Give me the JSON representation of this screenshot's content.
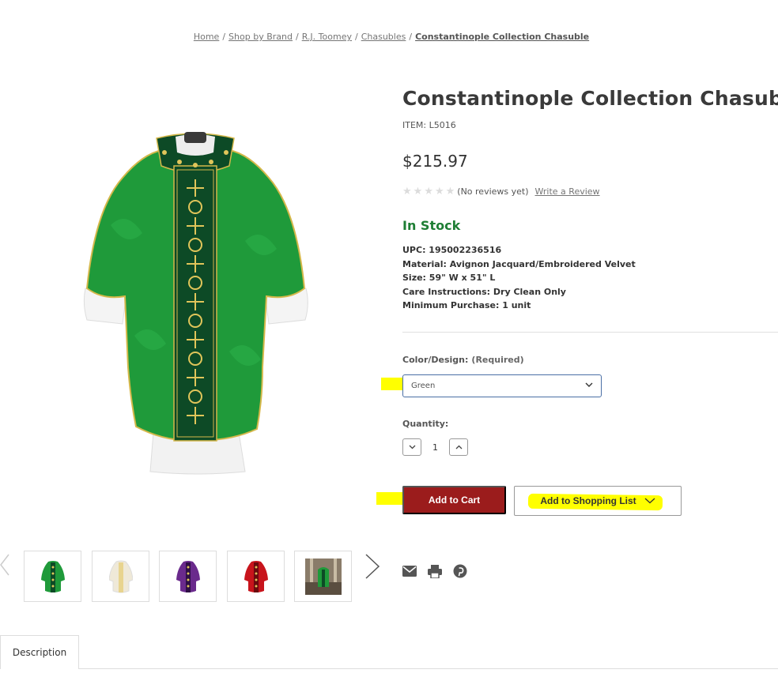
{
  "breadcrumbs": {
    "items": [
      "Home",
      "Shop by Brand",
      "R.J. Toomey",
      "Chasubles",
      "Constantinople Collection Chasuble"
    ],
    "separator": "/"
  },
  "product": {
    "title": "Constantinople Collection Chasuble",
    "sku": "ITEM: L5016",
    "price": "$215.97",
    "rating": {
      "stars": 0,
      "max_stars": 5,
      "reviews_text": "(No reviews yet)",
      "write_review": "Write a Review"
    },
    "stock": "In Stock",
    "specs": [
      "UPC: 195002236516",
      "Material: Avignon Jacquard/Embroidered Velvet",
      "Size: 59\" W x 51\" L",
      "Care Instructions: Dry Clean Only",
      "Minimum Purchase: 1 unit"
    ]
  },
  "form": {
    "color_label": "Color/Design:",
    "color_required": "(Required)",
    "color_value": "Green",
    "quantity_label": "Quantity:",
    "quantity_value": "1"
  },
  "actions": {
    "add_to_cart": "Add to Cart",
    "add_to_list": "Add to Shopping List"
  },
  "thumbnails": [
    {
      "name": "green-chasuble",
      "color": "#1f9a3a"
    },
    {
      "name": "white-chasuble",
      "color": "#efe9d8"
    },
    {
      "name": "purple-chasuble",
      "color": "#6a2a8c"
    },
    {
      "name": "red-chasuble",
      "color": "#c8141c"
    },
    {
      "name": "church-scene",
      "color": "#8a7c6a"
    }
  ],
  "tabs": {
    "description": "Description"
  },
  "colors": {
    "in_stock": "#1e7e34",
    "cart_button": "#9b1c1c",
    "select_border": "#4a6fa5",
    "highlight": "#ffff00"
  },
  "icons": [
    "mail-icon",
    "print-icon",
    "pinterest-icon",
    "chevron-down-icon",
    "chevron-up-icon",
    "chevron-left-icon",
    "chevron-right-icon",
    "star-icon"
  ]
}
